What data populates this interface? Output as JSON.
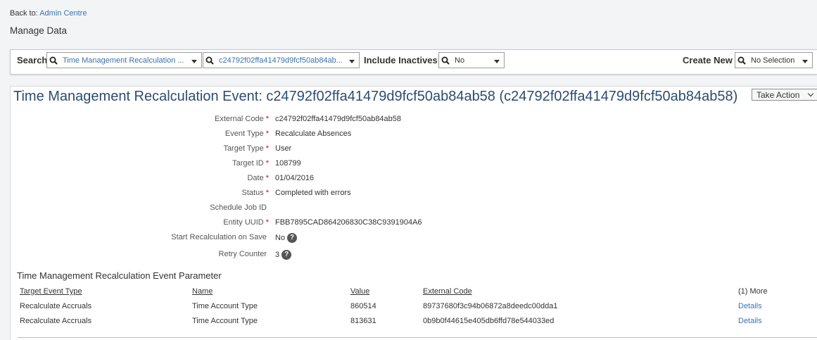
{
  "breadcrumb": {
    "prefix": "Back to:",
    "link": "Admin Centre"
  },
  "page_title": "Manage Data",
  "search_bar": {
    "search_label": "Search",
    "object_type": "Time Management Recalculation ...",
    "record_id": "c24792f02ffa41479d9fcf50ab84ab...",
    "include_inactives_label": "Include Inactives:",
    "include_inactives_value": "No",
    "create_new_label": "Create New",
    "create_new_value": "No Selection"
  },
  "record": {
    "title": "Time Management Recalculation Event: c24792f02ffa41479d9fcf50ab84ab58 (c24792f02ffa41479d9fcf50ab84ab58)",
    "take_action_label": "Take Action",
    "fields": [
      {
        "label": "External Code",
        "value": "c24792f02ffa41479d9fcf50ab84ab58",
        "required": "*"
      },
      {
        "label": "Event Type",
        "value": "Recalculate Absences",
        "required": "*"
      },
      {
        "label": "Target Type",
        "value": "User",
        "required": "*"
      },
      {
        "label": "Target ID",
        "value": "108799",
        "required": "*"
      },
      {
        "label": "Date",
        "value": "01/04/2016",
        "required": "*"
      },
      {
        "label": "Status",
        "value": "Completed with errors",
        "required": "*"
      },
      {
        "label": "Schedule Job ID",
        "value": "",
        "required": ""
      },
      {
        "label": "Entity UUID",
        "value": "FBB7895CAD864206830C38C9391904A6",
        "required": "*"
      },
      {
        "label": "Start Recalculation on Save",
        "value": "No",
        "required": ""
      },
      {
        "label": "Retry Counter",
        "value": "3",
        "required": ""
      }
    ],
    "help_glyph": "?"
  },
  "parameters": {
    "title": "Time Management Recalculation Event Parameter",
    "columns": [
      "Target Event Type",
      "Name",
      "Value",
      "External Code",
      "(1) More"
    ],
    "rows": [
      [
        "Recalculate Accruals",
        "Time Account Type",
        "860514",
        "89737680f3c94b06872a8deedc00dda1",
        "Details"
      ],
      [
        "Recalculate Accruals",
        "Time Account Type",
        "813631",
        "0b9b0f44615e405db6ffd78e544033ed",
        "Details"
      ]
    ]
  },
  "icons": {
    "search": "search-icon",
    "dropdown": "chevron-down-icon",
    "help": "help-icon"
  },
  "colors": {
    "link": "#3b73af",
    "title": "#2a4d6e",
    "required": "#d0021b",
    "background": "#f2f4f6"
  }
}
